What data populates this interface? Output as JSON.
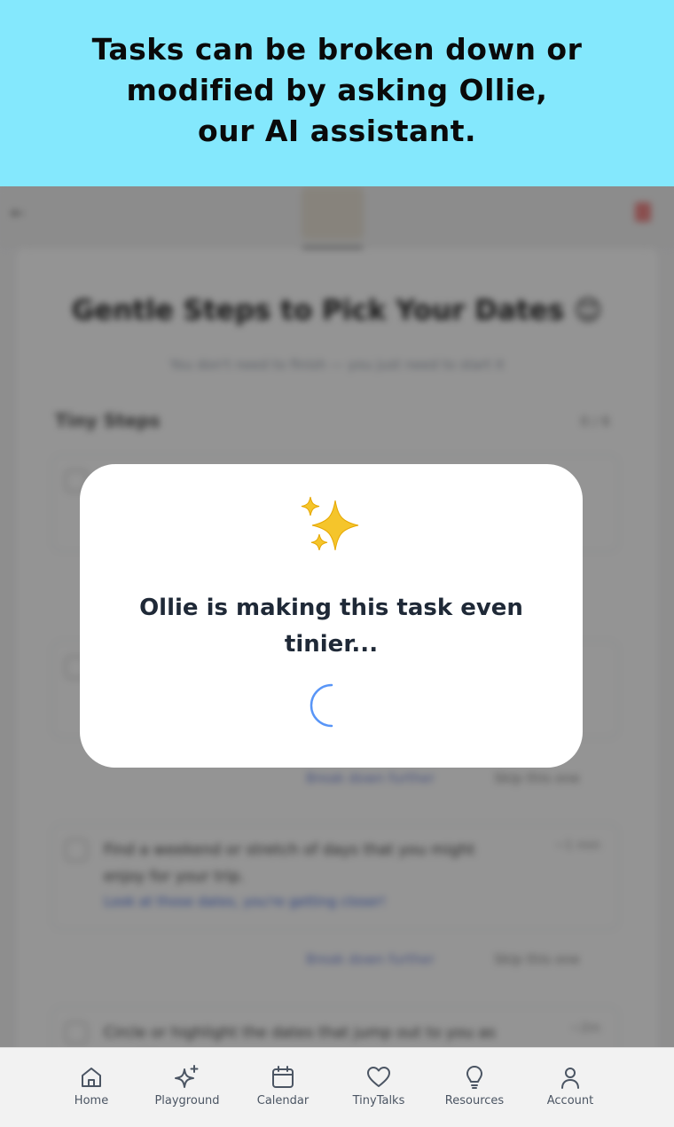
{
  "banner": {
    "text": "Tasks can be broken down or\nmodified by asking Ollie,\nour AI assistant."
  },
  "background": {
    "title": "Gentle Steps to Pick Your Dates 😊",
    "subtitle": "You don't need to finish — you just need to start it",
    "steps_heading": "Tiny Steps",
    "steps_count": "0 / 6",
    "tasks": [
      {
        "text": "Find a weekend or stretch of days that you might enjoy for your trip.",
        "time": "~1 min",
        "link": "Look at those dates, you're getting closer!"
      },
      {
        "text": "Circle or highlight the dates that jump out to you as possible",
        "time": "~2m"
      }
    ],
    "action_break": "Break down further",
    "action_skip": "Skip this one"
  },
  "modal": {
    "icon": "sparkles-icon",
    "message": "Ollie is making this task even tinier..."
  },
  "nav": {
    "items": [
      {
        "label": "Home",
        "icon": "home-icon"
      },
      {
        "label": "Playground",
        "icon": "sparkle-icon"
      },
      {
        "label": "Calendar",
        "icon": "calendar-icon"
      },
      {
        "label": "TinyTalks",
        "icon": "heart-icon"
      },
      {
        "label": "Resources",
        "icon": "lightbulb-icon"
      },
      {
        "label": "Account",
        "icon": "user-icon"
      }
    ]
  },
  "colors": {
    "banner_bg": "#84e8fd",
    "spinner": "#3b82f6",
    "nav_bg": "#f2f2f2"
  }
}
